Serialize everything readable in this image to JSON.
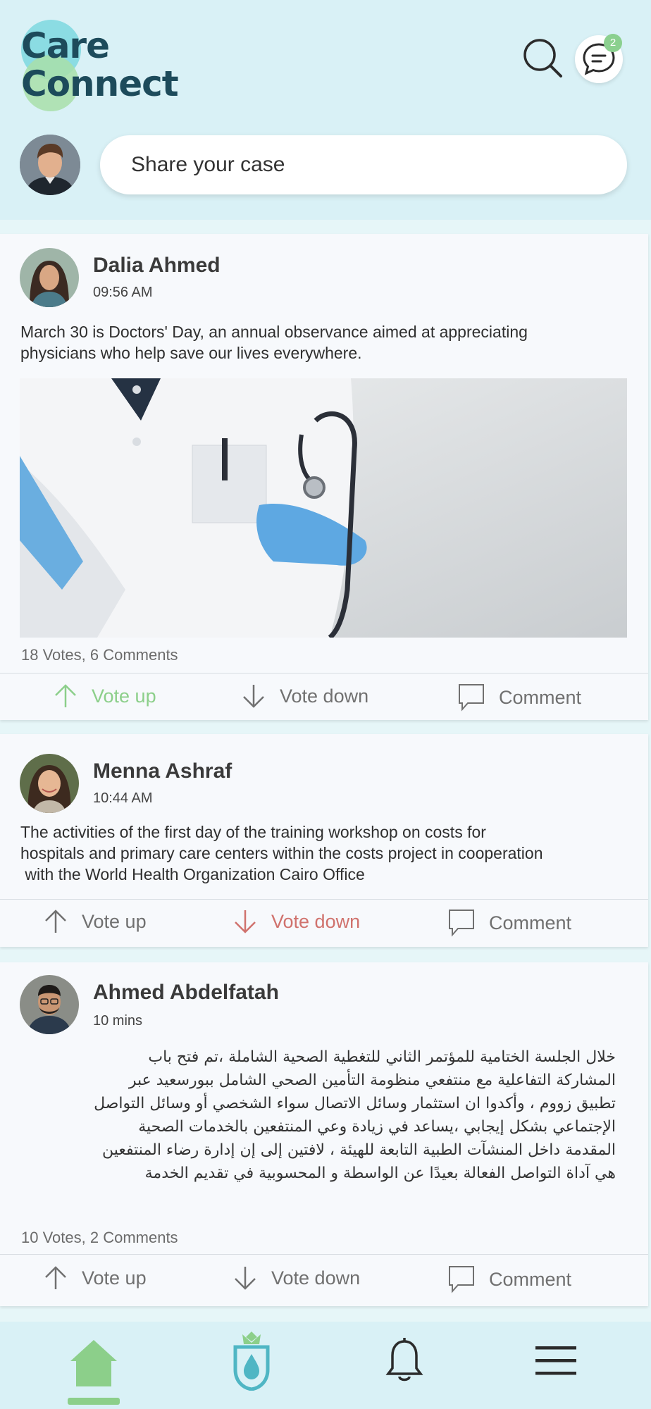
{
  "app": {
    "logo_line1": "Care",
    "logo_line2": "Connect"
  },
  "header": {
    "message_badge": "2",
    "share_placeholder": "Share your case"
  },
  "colors": {
    "accent_green": "#8ccf8a",
    "accent_red": "#d0726d",
    "header_bg": "#d9f1f6",
    "logo_text": "#1d4b5b"
  },
  "icons": [
    "search-icon",
    "chat-icon",
    "arrow-up-icon",
    "arrow-down-icon",
    "comment-icon",
    "home-icon",
    "care-logo-icon",
    "bell-icon",
    "menu-icon"
  ],
  "posts": [
    {
      "author": "Dalia Ahmed",
      "time": "09:56 AM",
      "text_lines": [
        "March 30 is Doctors' Day, an annual observance aimed at appreciating",
        "physicians who help save our lives everywhere."
      ],
      "stats": "18 Votes, 6 Comments",
      "vote_up": "Vote up",
      "vote_down": "Vote down",
      "comment": "Comment",
      "active_vote": "up"
    },
    {
      "author": "Menna Ashraf",
      "time": "10:44 AM",
      "text_lines": [
        "The activities of the first day of the training workshop on costs for",
        "hospitals and primary care centers within the costs project in cooperation",
        " with the World Health Organization Cairo Office"
      ],
      "vote_up": "Vote up",
      "vote_down": "Vote down",
      "comment": "Comment",
      "active_vote": "down"
    },
    {
      "author": "Ahmed Abdelfatah",
      "time": "10 mins",
      "text_lines": [
        "خلال الجلسة الختامية للمؤتمر الثاني للتغطية الصحية الشاملة ،تم فتح باب",
        "المشاركة التفاعلية مع منتفعي منظومة التأمين الصحي الشامل ببورسعيد عبر",
        "تطبيق زووم ، وأكدوا ان استثمار وسائل الاتصال سواء الشخصي أو وسائل التواصل",
        "الإجتماعي بشكل إيجابي ،يساعد في زيادة وعي المنتفعين بالخدمات الصحية",
        "المقدمة داخل المنشآت الطبية التابعة للهيئة ، لافتين إلى إن إدارة رضاء المنتفعين",
        "هي آداة التواصل الفعالة بعيدًا عن الواسطة و المحسوبية في تقديم الخدمة"
      ],
      "stats": "10 Votes, 2 Comments",
      "vote_up": "Vote up",
      "vote_down": "Vote down",
      "comment": "Comment",
      "active_vote": "none"
    }
  ]
}
